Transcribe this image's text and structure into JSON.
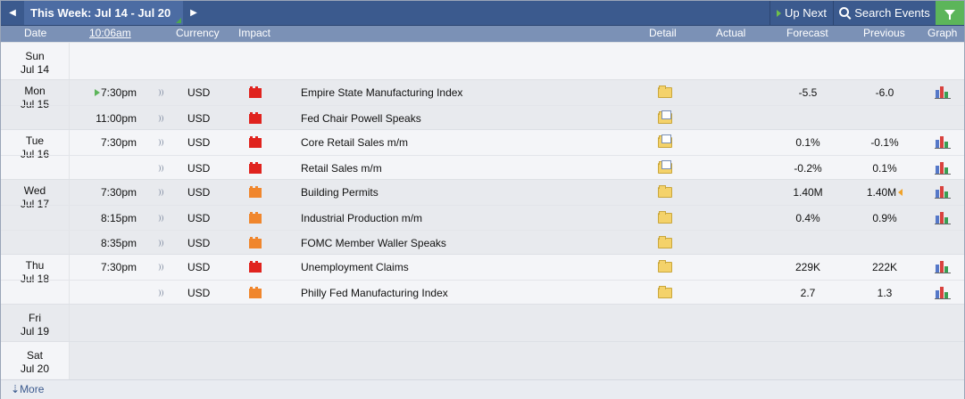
{
  "toolbar": {
    "prev_icon": "◀",
    "week_label": "This Week: Jul 14 - Jul 20",
    "next_icon": "▶",
    "up_next_label": "Up Next",
    "search_label": "Search Events"
  },
  "columns": {
    "date": "Date",
    "time": "10:06am",
    "currency": "Currency",
    "impact": "Impact",
    "detail": "Detail",
    "actual": "Actual",
    "forecast": "Forecast",
    "previous": "Previous",
    "graph": "Graph"
  },
  "colors": {
    "toolbar_bg": "#3b5a8e",
    "header_bg": "#7b91b6",
    "high_impact": "#e0231e",
    "medium_impact": "#f0862d",
    "filter_bg": "#5cb55a"
  },
  "days": [
    {
      "dow": "Sun",
      "date": "Jul 14",
      "events": []
    },
    {
      "dow": "Mon",
      "date": "Jul 15",
      "events": [
        {
          "time": "7:30pm",
          "currency": "USD",
          "impact": "high",
          "title": "Empire State Manufacturing Index",
          "actual": "",
          "forecast": "-5.5",
          "previous": "-6.0",
          "next": true
        },
        {
          "time": "11:00pm",
          "currency": "USD",
          "impact": "high",
          "title": "Fed Chair Powell Speaks",
          "actual": "",
          "forecast": "",
          "previous": ""
        }
      ]
    },
    {
      "dow": "Tue",
      "date": "Jul 16",
      "events": [
        {
          "time": "7:30pm",
          "currency": "USD",
          "impact": "high",
          "title": "Core Retail Sales m/m",
          "actual": "",
          "forecast": "0.1%",
          "previous": "-0.1%"
        },
        {
          "time": "",
          "currency": "USD",
          "impact": "high",
          "title": "Retail Sales m/m",
          "actual": "",
          "forecast": "-0.2%",
          "previous": "0.1%"
        }
      ]
    },
    {
      "dow": "Wed",
      "date": "Jul 17",
      "events": [
        {
          "time": "7:30pm",
          "currency": "USD",
          "impact": "medium",
          "title": "Building Permits",
          "actual": "",
          "forecast": "1.40M",
          "previous": "1.40M",
          "revised": true
        },
        {
          "time": "8:15pm",
          "currency": "USD",
          "impact": "medium",
          "title": "Industrial Production m/m",
          "actual": "",
          "forecast": "0.4%",
          "previous": "0.9%"
        },
        {
          "time": "8:35pm",
          "currency": "USD",
          "impact": "medium",
          "title": "FOMC Member Waller Speaks",
          "actual": "",
          "forecast": "",
          "previous": ""
        }
      ]
    },
    {
      "dow": "Thu",
      "date": "Jul 18",
      "events": [
        {
          "time": "7:30pm",
          "currency": "USD",
          "impact": "high",
          "title": "Unemployment Claims",
          "actual": "",
          "forecast": "229K",
          "previous": "222K"
        },
        {
          "time": "",
          "currency": "USD",
          "impact": "medium",
          "title": "Philly Fed Manufacturing Index",
          "actual": "",
          "forecast": "2.7",
          "previous": "1.3"
        }
      ]
    },
    {
      "dow": "Fri",
      "date": "Jul 19",
      "events": []
    },
    {
      "dow": "Sat",
      "date": "Jul 20",
      "events": []
    }
  ],
  "footer": {
    "more_icon": "⇣",
    "more_label": "More"
  }
}
